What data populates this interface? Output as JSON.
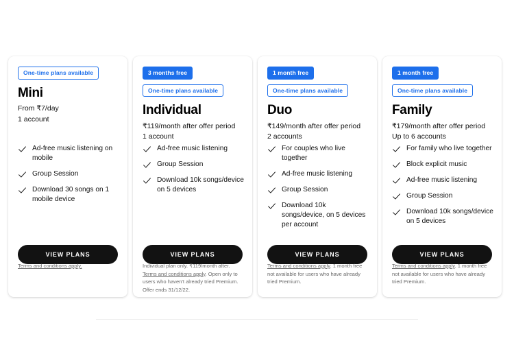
{
  "plans": [
    {
      "badges": [
        {
          "text": "One-time plans available",
          "style": "outline"
        }
      ],
      "name": "Mini",
      "price": "From ₹7/day",
      "accounts": "1 account",
      "features": [
        "Ad-free music listening on mobile",
        "Group Session",
        "Download 30 songs on 1 mobile device"
      ],
      "cta": "VIEW PLANS",
      "footer_prefix": "",
      "footer_link": "Terms and conditions apply.",
      "footer_suffix": ""
    },
    {
      "badges": [
        {
          "text": "3 months free",
          "style": "filled"
        },
        {
          "text": "One-time plans available",
          "style": "outline"
        }
      ],
      "name": "Individual",
      "price": "₹119/month after offer period",
      "accounts": "1 account",
      "features": [
        "Ad-free music listening",
        "Group Session",
        "Download 10k songs/device on 5 devices"
      ],
      "cta": "VIEW PLANS",
      "footer_prefix": "Individual plan only. ₹119/month after. ",
      "footer_link": "Terms and conditions apply",
      "footer_suffix": ". Open only to users who haven't already tried Premium. Offer ends 31/12/22."
    },
    {
      "badges": [
        {
          "text": "1 month free",
          "style": "filled"
        },
        {
          "text": "One-time plans available",
          "style": "outline"
        }
      ],
      "name": "Duo",
      "price": "₹149/month after offer period",
      "accounts": "2 accounts",
      "features": [
        "For couples who live together",
        "Ad-free music listening",
        "Group Session",
        "Download 10k songs/device, on 5 devices per account"
      ],
      "cta": "VIEW PLANS",
      "footer_prefix": "",
      "footer_link": "Terms and conditions apply",
      "footer_suffix": ". 1 month free not available for users who have already tried Premium."
    },
    {
      "badges": [
        {
          "text": "1 month free",
          "style": "filled"
        },
        {
          "text": "One-time plans available",
          "style": "outline"
        }
      ],
      "name": "Family",
      "price": "₹179/month after offer period",
      "accounts": "Up to 6 accounts",
      "features": [
        "For family who live together",
        "Block explicit music",
        "Ad-free music listening",
        "Group Session",
        "Download 10k songs/device on 5 devices"
      ],
      "cta": "VIEW PLANS",
      "footer_prefix": "",
      "footer_link": "Terms and conditions apply",
      "footer_suffix": ". 1 month free not available for users who have already tried Premium."
    }
  ],
  "colors": {
    "accent_blue": "#1d6feb",
    "button_black": "#121212",
    "footer_text": "#6a6a6a",
    "card_background": "#ffffff",
    "page_background": "#ffffff"
  },
  "icons": {
    "check": "check-icon"
  }
}
